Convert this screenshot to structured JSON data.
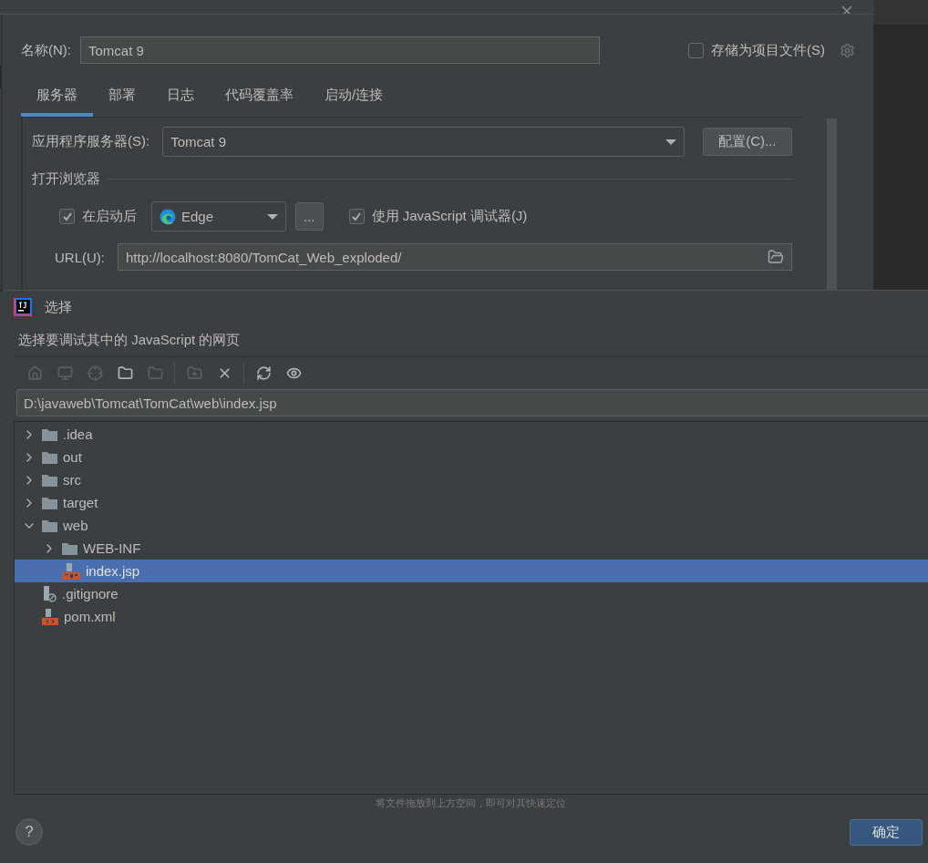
{
  "config_dialog": {
    "name_label": "名称(N):",
    "name_value": "Tomcat 9",
    "store_as_project_file": {
      "label": "存储为项目文件(S)",
      "checked": false
    },
    "tabs": [
      {
        "label": "服务器",
        "selected": true
      },
      {
        "label": "部署",
        "selected": false
      },
      {
        "label": "日志",
        "selected": false
      },
      {
        "label": "代码覆盖率",
        "selected": false
      },
      {
        "label": "启动/连接",
        "selected": false
      }
    ],
    "app_server_label": "应用程序服务器(S):",
    "app_server_value": "Tomcat 9",
    "configure_button": "配置(C)...",
    "open_browser_section": "打开浏览器",
    "after_launch": {
      "label": "在启动后",
      "checked": true
    },
    "browser_value": "Edge",
    "browse_button": "...",
    "js_debugger": {
      "label": "使用 JavaScript 调试器(J)",
      "checked": true
    },
    "url_label": "URL(U):",
    "url_value": "http://localhost:8080/TomCat_Web_exploded/"
  },
  "chooser_dialog": {
    "title": "选择",
    "description": "选择要调试其中的 JavaScript 的网页",
    "toolbar": [
      {
        "kind": "home",
        "disabled": true
      },
      {
        "kind": "desktop",
        "disabled": true
      },
      {
        "kind": "target",
        "disabled": true
      },
      {
        "kind": "folder",
        "disabled": false
      },
      {
        "kind": "folder",
        "disabled": true
      },
      {
        "kind": "separator"
      },
      {
        "kind": "new-folder",
        "disabled": true
      },
      {
        "kind": "delete",
        "disabled": false
      },
      {
        "kind": "separator"
      },
      {
        "kind": "refresh",
        "disabled": false
      },
      {
        "kind": "show-hidden",
        "disabled": false
      }
    ],
    "path_value": "D:\\javaweb\\Tomcat\\TomCat\\web\\index.jsp",
    "tree": [
      {
        "label": ".idea",
        "kind": "folder",
        "expanded": false,
        "selected": false
      },
      {
        "label": "out",
        "kind": "folder",
        "expanded": false,
        "selected": false
      },
      {
        "label": "src",
        "kind": "folder",
        "expanded": false,
        "selected": false
      },
      {
        "label": "target",
        "kind": "folder",
        "expanded": false,
        "selected": false
      },
      {
        "label": "web",
        "kind": "folder",
        "expanded": true,
        "selected": false,
        "children": [
          {
            "label": "WEB-INF",
            "kind": "folder",
            "expanded": false,
            "selected": false
          },
          {
            "label": "index.jsp",
            "kind": "jsp",
            "selected": true
          }
        ]
      },
      {
        "label": ".gitignore",
        "kind": "ignore",
        "selected": false
      },
      {
        "label": "pom.xml",
        "kind": "xml",
        "selected": false
      }
    ],
    "drop_hint": "将文件拖放到上方空间，即可对其快速定位",
    "help_button": "?",
    "ok_button": "确定"
  }
}
